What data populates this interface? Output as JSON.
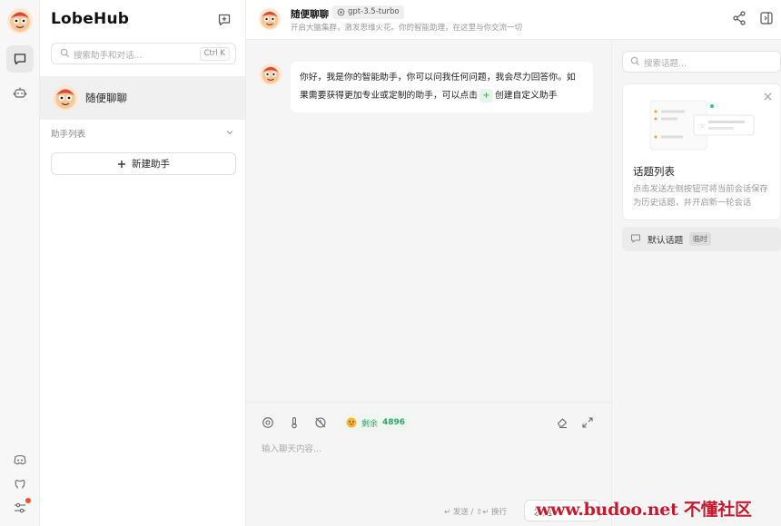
{
  "app": {
    "brand": "LobeHub"
  },
  "sessions": {
    "search_placeholder": "搜索助手和对话...",
    "search_shortcut": "Ctrl K",
    "active_item": "随便聊聊",
    "group_label": "助手列表",
    "new_assistant_label": "新建助手"
  },
  "chat_header": {
    "title": "随便聊聊",
    "model": "gpt-3.5-turbo",
    "subtitle": "开启大脑集群，激发思维火花。你的智能助理，在这里与你交流一切"
  },
  "message": {
    "text_before": "你好，我是你的智能助手，你可以问我任何问题，我会尽力回答你。如果需要获得更加专业或定制的助手，可以点击",
    "chip": "+",
    "text_after": "创建自定义助手"
  },
  "input": {
    "token_label": "剩余",
    "token_value": "4896",
    "placeholder": "输入聊天内容...",
    "send_hint": "↵ 发送 / ⇧↵ 换行",
    "send_label": "发送"
  },
  "topics": {
    "search_placeholder": "搜索话题...",
    "card_title": "话题列表",
    "card_desc": "点击发送左侧按钮可将当前会话保存为历史话题，并开启新一轮会话",
    "default_topic": "默认话题",
    "default_tag": "临时"
  },
  "watermark": "www.budoo.net 不懂社区",
  "colors": {
    "accent_green": "#2fa36b",
    "watermark_red": "#c7182c",
    "notify_dot": "#f5502c"
  },
  "icons": [
    "chat-icon",
    "robot-icon",
    "discord-icon",
    "github-icon",
    "settings-icon",
    "new-topic-icon",
    "share-icon",
    "panel-icon",
    "search-icon",
    "chevron-down-icon",
    "plus-icon",
    "model-icon",
    "thermometer-icon",
    "no-history-icon",
    "clear-icon",
    "expand-icon",
    "close-icon",
    "topic-icon"
  ]
}
